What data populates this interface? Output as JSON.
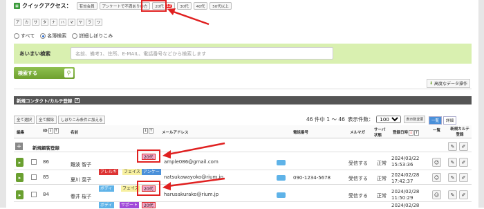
{
  "quick_access": {
    "title": "クイックアクセス：",
    "chips": [
      "有効会員",
      "アンケートで不満ありの方",
      "20代",
      "30代",
      "40代",
      "50代以上"
    ],
    "badge_count": "12"
  },
  "kana_tabs": [
    "ア",
    "カ",
    "サ",
    "タ",
    "ナ",
    "ハ",
    "マ",
    "ヤ",
    "ラ",
    "ワ"
  ],
  "search_mode": {
    "options": [
      "すべて",
      "名簿検索",
      "詳細しぼりこみ"
    ],
    "selected": "名簿検索"
  },
  "fuzzy_search": {
    "label": "あいまい検索",
    "placeholder": "名前、備考1、住所、E-MAIL、電話番号などから検索します"
  },
  "search_button": "検索する",
  "advanced_link": "高度なデータ操作",
  "section_title": "新規コンタクト/カルテ登録",
  "bulk_actions": [
    "全て選択",
    "全て解除",
    "しぼりこみ条件に加える"
  ],
  "paging": {
    "summary": "46 件中 1 ～ 46",
    "per_page_label": "表示件数：",
    "per_page": "100",
    "change_btn": "表示数変更"
  },
  "view_toggle": {
    "list": "一覧",
    "detail": "詳細"
  },
  "columns": {
    "edit": "編集",
    "id": "ID",
    "name": "名前",
    "email": "メールアドレス",
    "phone": "電話番号",
    "mailmag": "メルマガ",
    "server_status": "サーバ状態",
    "registered": "登録日時",
    "list": "一覧",
    "new_karte": "新規カルテ登録"
  },
  "new_customer_label": "新規顧客登録",
  "rows": [
    {
      "id": "86",
      "name": "難波 智子",
      "age_tag": "20代",
      "email": "ample086@gmail.com",
      "phone": "",
      "mailmag": "受信する",
      "status": "正常",
      "date": "2024/03/22",
      "time": "15:53:36",
      "tags": []
    },
    {
      "id": "85",
      "name": "夏川 葉子",
      "age_tag": "",
      "email": "natsukawayoko@rium.jp",
      "phone": "090-1234-5678",
      "mailmag": "受信する",
      "status": "正常",
      "date": "2024/02/28",
      "time": "17:42:37",
      "tags": [
        "アレルギ",
        "フェイス",
        "アンケー"
      ]
    },
    {
      "id": "84",
      "name": "春井 桜子",
      "age_tag": "20代",
      "email": "harusakurako@rium.jp",
      "phone": "",
      "mailmag": "受信する",
      "status": "正常",
      "date": "2024/02/28",
      "time": "11:50:29",
      "tags": [
        "ボディ",
        "フェイス"
      ]
    },
    {
      "id": "",
      "name": "",
      "age_tag": "",
      "email": "",
      "phone": "",
      "mailmag": "",
      "status": "",
      "date": "2024/02/28",
      "time": "",
      "tags": [
        "ボディ",
        "サポート",
        "20代"
      ]
    }
  ],
  "colors": {
    "accent_green": "#6ea02e",
    "search_bg": "#d9f0b0",
    "highlight": "#e02020",
    "tag_pink": "#f5a6c8"
  }
}
